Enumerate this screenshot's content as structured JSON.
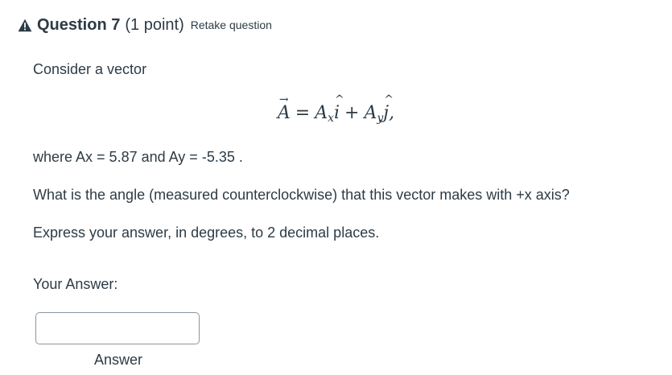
{
  "question": {
    "title": "Question 7",
    "points": "(1 point)",
    "retake_label": "Retake question",
    "icon": "warning-triangle-icon",
    "icon_color": "#2d3b45"
  },
  "body": {
    "intro": "Consider a vector",
    "equation": {
      "lhs": "A",
      "eq": "=",
      "term1_coef": "A",
      "term1_sub": "x",
      "term1_unit": "i",
      "plus": "+",
      "term2_coef": "A",
      "term2_sub": "y",
      "term2_unit": "j",
      "comma": ","
    },
    "given": "where Ax = 5.87  and Ay = -5.35 .",
    "prompt": "What is the angle (measured counterclockwise) that this vector makes with +x axis?",
    "instruction": "Express your answer, in degrees, to 2 decimal places."
  },
  "answer": {
    "heading": "Your Answer:",
    "value": "",
    "label": "Answer"
  }
}
